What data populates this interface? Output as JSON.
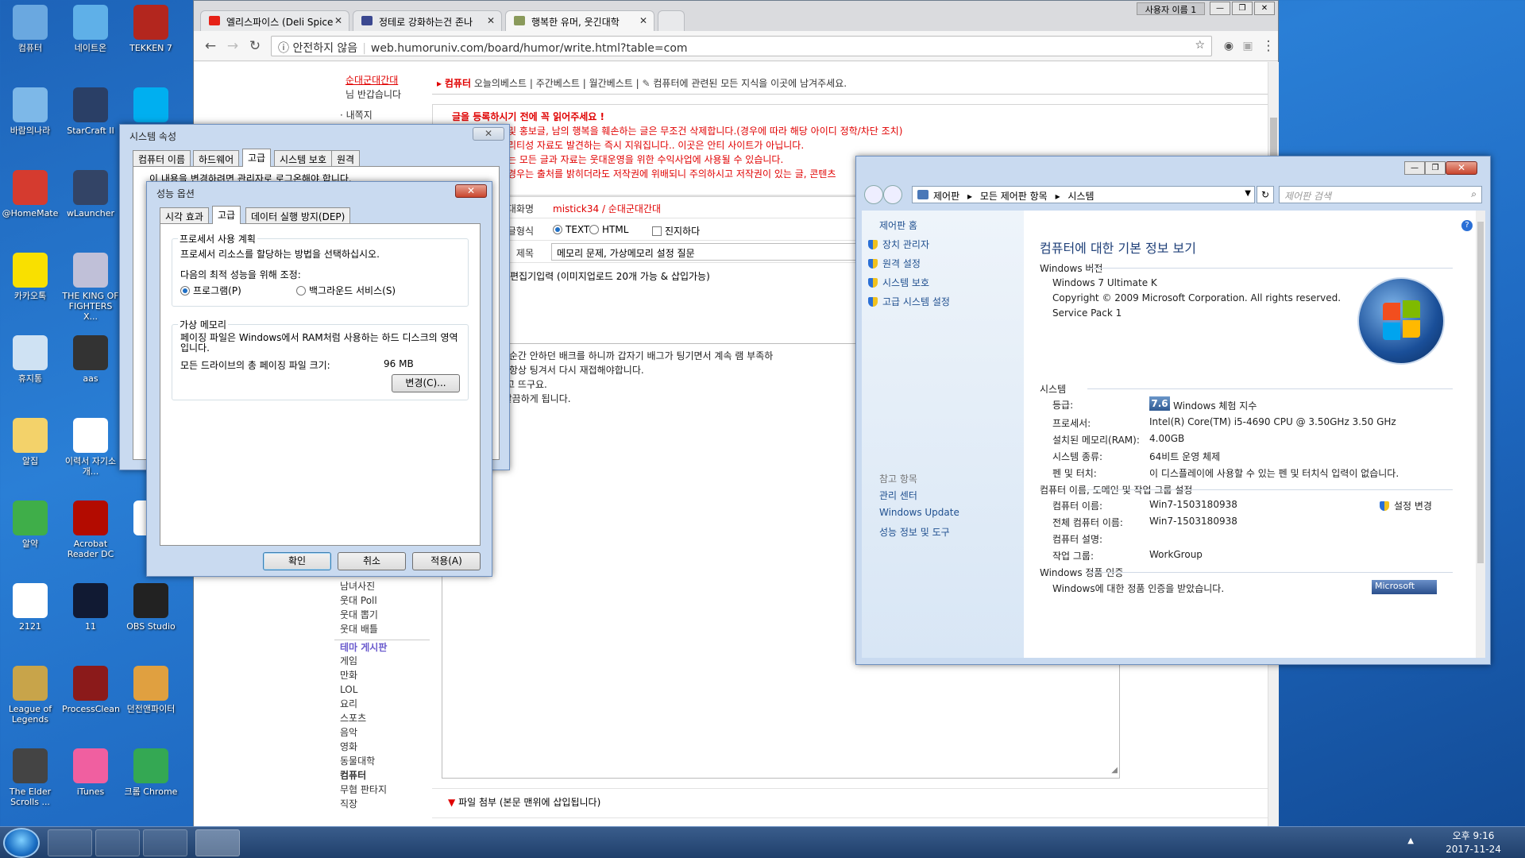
{
  "desktop": {
    "icons": [
      {
        "label": "컴퓨터",
        "color": "#6aa8e0"
      },
      {
        "label": "네이트온",
        "color": "#5fb0e8"
      },
      {
        "label": "TEKKEN 7",
        "color": "#b3261e"
      },
      {
        "label": "바람의나라",
        "color": "#7db8e8"
      },
      {
        "label": "StarCraft II",
        "color": "#2a3f66"
      },
      {
        "label": "Skype",
        "color": "#00aff0"
      },
      {
        "label": "@HomeMate",
        "color": "#d53b2f"
      },
      {
        "label": "wLauncher",
        "color": "#334466"
      },
      {
        "label": "카카오톡",
        "color": "#f9e000"
      },
      {
        "label": "THE KING OF FIGHTERS X...",
        "color": "#c0c0d8"
      },
      {
        "label": "휴지통",
        "color": "#cfe2f3"
      },
      {
        "label": "aas",
        "color": "#333"
      },
      {
        "label": "알집",
        "color": "#f3d26a"
      },
      {
        "label": "이력서 자기소개...",
        "color": "#ffffff"
      },
      {
        "label": "알약",
        "color": "#3fae49"
      },
      {
        "label": "Acrobat Reader DC",
        "color": "#b30b00"
      },
      {
        "label": "U",
        "color": "#ffffff"
      },
      {
        "label": "2121",
        "color": "#ffffff"
      },
      {
        "label": "11",
        "color": "#111a33"
      },
      {
        "label": "OBS Studio",
        "color": "#222"
      },
      {
        "label": "League of Legends",
        "color": "#c8a44a"
      },
      {
        "label": "ProcessClean",
        "color": "#8b1a1a"
      },
      {
        "label": "던전앤파이터",
        "color": "#e0a040"
      },
      {
        "label": "The Elder Scrolls ...",
        "color": "#444"
      },
      {
        "label": "iTunes",
        "color": "#f05fa0"
      },
      {
        "label": "크롬 Chrome",
        "color": "#34a853"
      }
    ]
  },
  "taskbar": {
    "time": "오후 9:16",
    "date": "2017-11-24"
  },
  "browser": {
    "tabs": [
      {
        "title": "엘리스파이스 (Deli Spice",
        "favicon_color": "#e62117"
      },
      {
        "title": "정테로 강화하는건 존나",
        "favicon_color": "#3b4890"
      },
      {
        "title": "행복한 유머, 웃긴대학",
        "favicon_color": "#8a9a5b"
      }
    ],
    "user_badge": "사용자 이름 1",
    "security": "안전하지 않음",
    "url": "web.humoruniv.com/board/humor/write.html?table=com",
    "sidebar_top": [
      "순대군대간대",
      "님 반갑습니다",
      "· 내쪽지"
    ],
    "sidebar_bottom": [
      "남녀사진",
      "웃대 Poll",
      "웃대 뽑기",
      "웃대 배틀",
      "테마 게시판",
      "게임",
      "만화",
      "LOL",
      "요리",
      "스포츠",
      "음악",
      "영화",
      "동물대학",
      "컴퓨터",
      "무협 판타지",
      "직장"
    ],
    "nav": {
      "active": "컴퓨터",
      "items": "오늘의베스트 | 주간베스트 | 월간베스트 |",
      "desc": "컴퓨터에 관련된 모든 지식을 이곳에 남겨주세요."
    },
    "notice": {
      "heading": "글을 등록하시기 전에 꼭 읽어주세요 !",
      "lines": [
        "및 홍보글, 남의 행복을 훼손하는 글은 무조건 삭제합니다.(경우에 따라 해당 아이디 정학/차단 조치)",
        "리티성 자료도 발견하는 즉시 지워집니다.. 이곳은 안티 사이트가 아닙니다.",
        "는 모든 글과 자료는 웃대운영을 위한 수익사업에 사용될 수 있습니다.",
        "경우는 출처를 밝히더라도 저작권에 위배되니 주의하시고 저작권이 있는 글, 콘텐츠"
      ]
    },
    "form": {
      "id_label": "아이디 / 대화명",
      "id_value": "mistick34 / 순대군대간대",
      "format_label": "글형식",
      "format_text": "TEXT",
      "format_html": "HTML",
      "serious": "진지하다",
      "title_label": "제목",
      "title_value": "메모리 문제, 가상메모리 설정 질문",
      "editor_option": "편집기입력 (이미지업로드 20개 가능 & 삽입가능)",
      "body_lines": [
        "고 있다가 어느순간 안하던 배크를 하니까 갑자기 배그가 팅기면서 계속 램 부족하",
        "롤도 시작할때 항상 팅겨서 다시 재접해야합니다.",
        "리가 부족하다고 뜨구요.",
        "런 알림 없이 깔끔하게 됩니다."
      ],
      "attach": "파일 첨부 (본문 맨위에 삽입됩니다)"
    }
  },
  "sysprops": {
    "title": "시스템 속성",
    "tabs": [
      "컴퓨터 이름",
      "하드웨어",
      "고급",
      "시스템 보호",
      "원격"
    ],
    "hint": "이 내용을 변경하려면 관리자로 로그온해야 합니다."
  },
  "perf": {
    "title": "성능 옵션",
    "tabs": [
      "시각 효과",
      "고급",
      "데이터 실행 방지(DEP)"
    ],
    "proc_group": "프로세서 사용 계획",
    "proc_desc": "프로세서 리소스를 할당하는 방법을 선택하십시오.",
    "adjust": "다음의 최적 성능을 위해 조정:",
    "opt_programs": "프로그램(P)",
    "opt_bg": "백그라운드 서비스(S)",
    "vm_group": "가상 메모리",
    "vm_desc": "페이징 파일은 Windows에서 RAM처럼 사용하는 하드 디스크의 영역입니다.",
    "vm_total_label": "모든 드라이브의 총 페이징 파일 크기:",
    "vm_total_value": "96 MB",
    "change_btn": "변경(C)...",
    "ok": "확인",
    "cancel": "취소",
    "apply": "적용(A)"
  },
  "system": {
    "breadcrumb": [
      "제어판",
      "모든 제어판 항목",
      "시스템"
    ],
    "search_placeholder": "제어판 검색",
    "left_home": "제어판 홈",
    "left_links": [
      "장치 관리자",
      "원격 설정",
      "시스템 보호",
      "고급 시스템 설정"
    ],
    "see_also": "참고 항목",
    "see_links": [
      "관리 센터",
      "Windows Update",
      "성능 정보 및 도구"
    ],
    "heading": "컴퓨터에 대한 기본 정보 보기",
    "edition_section": "Windows 버전",
    "edition": "Windows 7 Ultimate K",
    "copyright": "Copyright © 2009 Microsoft Corporation. All rights reserved.",
    "sp": "Service Pack 1",
    "system_section": "시스템",
    "rating_label": "등급:",
    "rating_value": "7.6",
    "rating_link": "Windows 체험 지수",
    "rows": [
      {
        "k": "프로세서:",
        "v": "Intel(R) Core(TM) i5-4690 CPU @ 3.50GHz   3.50 GHz"
      },
      {
        "k": "설치된 메모리(RAM):",
        "v": "4.00GB"
      },
      {
        "k": "시스템 종류:",
        "v": "64비트 운영 체제"
      },
      {
        "k": "펜 및 터치:",
        "v": "이 디스플레이에 사용할 수 있는 펜 및 터치식 입력이 없습니다."
      }
    ],
    "name_section": "컴퓨터 이름, 도메인 및 작업 그룹 설정",
    "name_rows": [
      {
        "k": "컴퓨터 이름:",
        "v": "Win7-1503180938"
      },
      {
        "k": "전체 컴퓨터 이름:",
        "v": "Win7-1503180938"
      },
      {
        "k": "컴퓨터 설명:",
        "v": ""
      },
      {
        "k": "작업 그룹:",
        "v": "WorkGroup"
      }
    ],
    "change_settings": "설정 변경",
    "activation_section": "Windows 정품 인증",
    "activation": "Windows에 대한 정품 인증을 받았습니다.",
    "ms_badge": "Microsoft"
  }
}
